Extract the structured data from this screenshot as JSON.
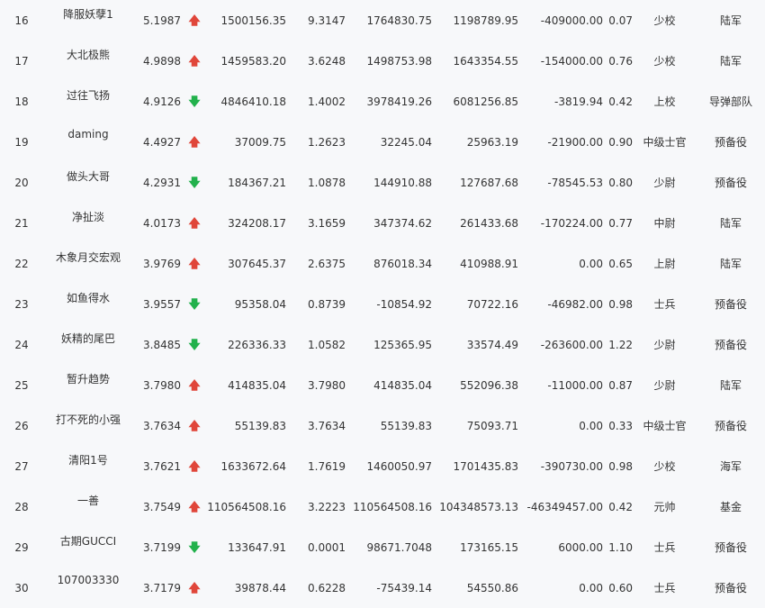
{
  "colors": {
    "up": "#e0463a",
    "down": "#22b14c",
    "background": "#f7f8fa"
  },
  "rows": [
    {
      "rank": "16",
      "name": "降服妖孽1",
      "score": "5.1987",
      "trend": "up",
      "v1": "1500156.35",
      "v2": "9.3147",
      "v3": "1764830.75",
      "v4": "1198789.95",
      "v5": "-409000.00",
      "v6": "0.07",
      "title": "少校",
      "branch": "陆军"
    },
    {
      "rank": "17",
      "name": "大北极熊",
      "score": "4.9898",
      "trend": "up",
      "v1": "1459583.20",
      "v2": "3.6248",
      "v3": "1498753.98",
      "v4": "1643354.55",
      "v5": "-154000.00",
      "v6": "0.76",
      "title": "少校",
      "branch": "陆军"
    },
    {
      "rank": "18",
      "name": "过往飞扬",
      "score": "4.9126",
      "trend": "down",
      "v1": "4846410.18",
      "v2": "1.4002",
      "v3": "3978419.26",
      "v4": "6081256.85",
      "v5": "-3819.94",
      "v6": "0.42",
      "title": "上校",
      "branch": "导弹部队"
    },
    {
      "rank": "19",
      "name": "daming",
      "score": "4.4927",
      "trend": "up",
      "v1": "37009.75",
      "v2": "1.2623",
      "v3": "32245.04",
      "v4": "25963.19",
      "v5": "-21900.00",
      "v6": "0.90",
      "title": "中级士官",
      "branch": "预备役"
    },
    {
      "rank": "20",
      "name": "做头大哥",
      "score": "4.2931",
      "trend": "down",
      "v1": "184367.21",
      "v2": "1.0878",
      "v3": "144910.88",
      "v4": "127687.68",
      "v5": "-78545.53",
      "v6": "0.80",
      "title": "少尉",
      "branch": "预备役"
    },
    {
      "rank": "21",
      "name": "净扯淡",
      "score": "4.0173",
      "trend": "up",
      "v1": "324208.17",
      "v2": "3.1659",
      "v3": "347374.62",
      "v4": "261433.68",
      "v5": "-170224.00",
      "v6": "0.77",
      "title": "中尉",
      "branch": "陆军"
    },
    {
      "rank": "22",
      "name": "木象月交宏观",
      "score": "3.9769",
      "trend": "up",
      "v1": "307645.37",
      "v2": "2.6375",
      "v3": "876018.34",
      "v4": "410988.91",
      "v5": "0.00",
      "v6": "0.65",
      "title": "上尉",
      "branch": "陆军"
    },
    {
      "rank": "23",
      "name": "如鱼得水",
      "score": "3.9557",
      "trend": "down",
      "v1": "95358.04",
      "v2": "0.8739",
      "v3": "-10854.92",
      "v4": "70722.16",
      "v5": "-46982.00",
      "v6": "0.98",
      "title": "士兵",
      "branch": "预备役"
    },
    {
      "rank": "24",
      "name": "妖精的尾巴",
      "score": "3.8485",
      "trend": "down",
      "v1": "226336.33",
      "v2": "1.0582",
      "v3": "125365.95",
      "v4": "33574.49",
      "v5": "-263600.00",
      "v6": "1.22",
      "title": "少尉",
      "branch": "预备役"
    },
    {
      "rank": "25",
      "name": "暂升趋势",
      "score": "3.7980",
      "trend": "up",
      "v1": "414835.04",
      "v2": "3.7980",
      "v3": "414835.04",
      "v4": "552096.38",
      "v5": "-11000.00",
      "v6": "0.87",
      "title": "少尉",
      "branch": "陆军"
    },
    {
      "rank": "26",
      "name": "打不死的小强",
      "score": "3.7634",
      "trend": "up",
      "v1": "55139.83",
      "v2": "3.7634",
      "v3": "55139.83",
      "v4": "75093.71",
      "v5": "0.00",
      "v6": "0.33",
      "title": "中级士官",
      "branch": "预备役"
    },
    {
      "rank": "27",
      "name": "清阳1号",
      "score": "3.7621",
      "trend": "up",
      "v1": "1633672.64",
      "v2": "1.7619",
      "v3": "1460050.97",
      "v4": "1701435.83",
      "v5": "-390730.00",
      "v6": "0.98",
      "title": "少校",
      "branch": "海军"
    },
    {
      "rank": "28",
      "name": "一善",
      "score": "3.7549",
      "trend": "up",
      "v1": "110564508.16",
      "v2": "3.2223",
      "v3": "110564508.16",
      "v4": "104348573.13",
      "v5": "-46349457.00",
      "v6": "0.42",
      "title": "元帅",
      "branch": "基金"
    },
    {
      "rank": "29",
      "name": "古期GUCCI",
      "score": "3.7199",
      "trend": "down",
      "v1": "133647.91",
      "v2": "0.0001",
      "v3": "98671.7048",
      "v4": "173165.15",
      "v5": "6000.00",
      "v6": "1.10",
      "title": "士兵",
      "branch": "预备役"
    },
    {
      "rank": "30",
      "name": "107003330",
      "score": "3.7179",
      "trend": "up",
      "v1": "39878.44",
      "v2": "0.6228",
      "v3": "-75439.14",
      "v4": "54550.86",
      "v5": "0.00",
      "v6": "0.60",
      "title": "士兵",
      "branch": "预备役"
    }
  ]
}
